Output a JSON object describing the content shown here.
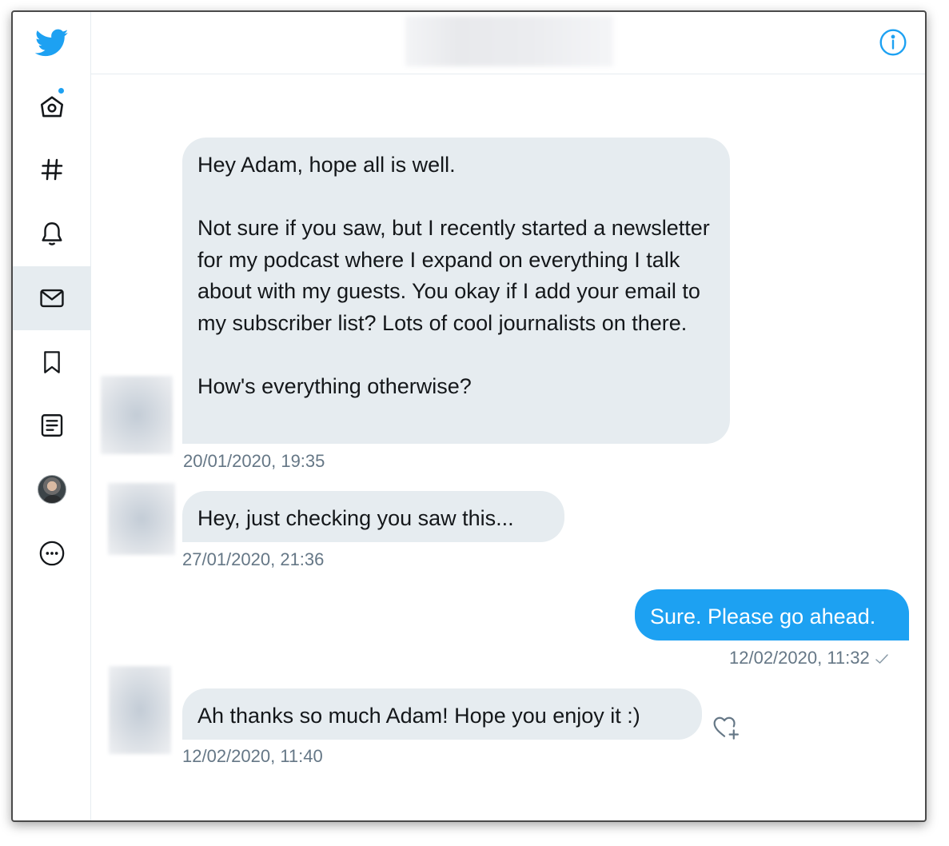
{
  "sidebar": {
    "items": [
      {
        "name": "twitter-logo-icon"
      },
      {
        "name": "home-icon",
        "notification_dot": true
      },
      {
        "name": "explore-hashtag-icon"
      },
      {
        "name": "notifications-bell-icon"
      },
      {
        "name": "messages-mail-icon",
        "active": true
      },
      {
        "name": "bookmarks-icon"
      },
      {
        "name": "lists-icon"
      },
      {
        "name": "profile-avatar"
      },
      {
        "name": "more-icon"
      }
    ]
  },
  "header": {
    "info_icon": "info-icon"
  },
  "conversation": {
    "messages": [
      {
        "direction": "incoming",
        "text": "Hey Adam, hope all is well.\n\nNot sure if you saw, but I recently started a newsletter for my podcast where I expand on everything I talk about with my guests. You okay if I add your email to my subscriber list? Lots of cool journalists on there.\n\nHow's everything otherwise?",
        "timestamp": "20/01/2020, 19:35"
      },
      {
        "direction": "incoming",
        "text": "Hey, just checking you saw this...",
        "timestamp": "27/01/2020, 21:36"
      },
      {
        "direction": "outgoing",
        "text": "Sure. Please go ahead.",
        "timestamp": "12/02/2020, 11:32"
      },
      {
        "direction": "incoming",
        "text": "Ah thanks so much Adam! Hope you enjoy it :)",
        "timestamp": "12/02/2020, 11:40"
      }
    ]
  },
  "colors": {
    "accent": "#1da1f2",
    "incoming_bubble": "#e6ecf0",
    "timestamp": "#657786",
    "text": "#14171a"
  }
}
